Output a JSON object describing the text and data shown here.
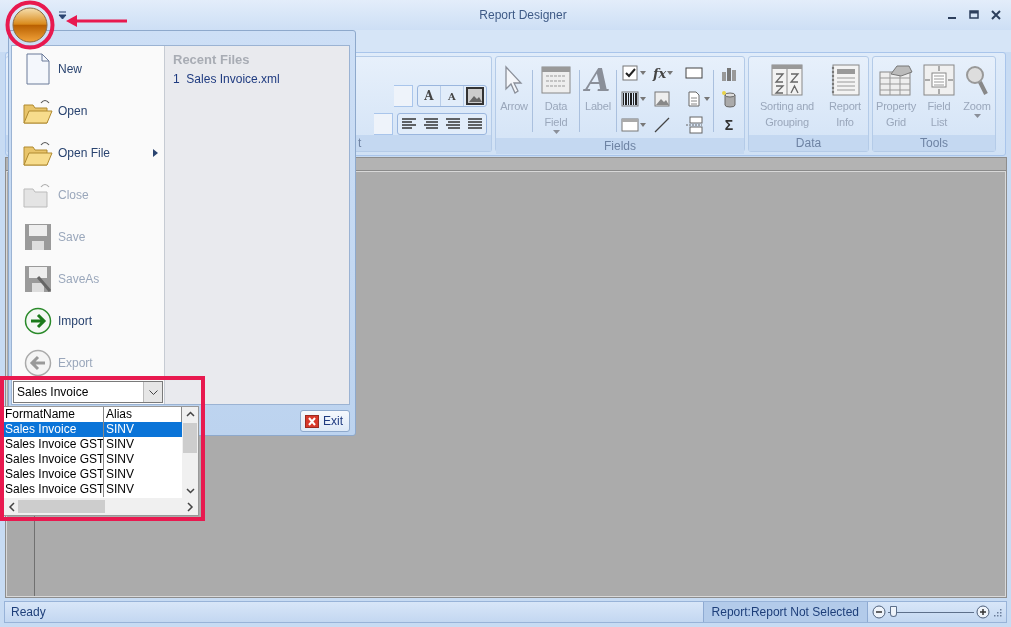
{
  "window": {
    "title": "Report Designer"
  },
  "ribbon": {
    "format_group": {
      "label": "t",
      "grow_glyph": "A",
      "shrink_glyph": "A"
    },
    "groups": [
      {
        "label": "Fields",
        "buttons": [
          {
            "label": "Arrow",
            "kind": "arrow",
            "disabled": true,
            "menu": false
          },
          {
            "label": "Data Field",
            "kind": "table",
            "disabled": true,
            "menu": true
          },
          {
            "label": "Label",
            "kind": "label",
            "disabled": true,
            "menu": false,
            "glyph": "A"
          }
        ],
        "tools": {
          "formula": "fx",
          "sum": "Σ"
        }
      },
      {
        "label": "Data",
        "buttons": [
          {
            "label": "Sorting and Grouping",
            "kind": "sort",
            "disabled": true,
            "menu": false
          },
          {
            "label": "Report Info",
            "kind": "info",
            "disabled": true,
            "menu": false
          }
        ]
      },
      {
        "label": "Tools",
        "buttons": [
          {
            "label": "Property Grid",
            "kind": "grid",
            "disabled": true,
            "menu": false
          },
          {
            "label": "Field List",
            "kind": "fieldlist",
            "disabled": true,
            "menu": false
          },
          {
            "label": "Zoom",
            "kind": "zoom",
            "disabled": true,
            "menu": true
          }
        ]
      }
    ]
  },
  "app_menu": {
    "items": [
      {
        "label": "New",
        "kind": "new",
        "disabled": false,
        "submenu": false
      },
      {
        "label": "Open",
        "kind": "open",
        "disabled": false,
        "submenu": false
      },
      {
        "label": "Open File",
        "kind": "open",
        "disabled": false,
        "submenu": true
      },
      {
        "label": "Close",
        "kind": "close",
        "disabled": true,
        "submenu": false
      },
      {
        "label": "Save",
        "kind": "save",
        "disabled": true,
        "submenu": false
      },
      {
        "label": "SaveAs",
        "kind": "saveas",
        "disabled": true,
        "submenu": false
      },
      {
        "label": "Import",
        "kind": "import",
        "disabled": false,
        "submenu": false
      },
      {
        "label": "Export",
        "kind": "export",
        "disabled": true,
        "submenu": false
      }
    ],
    "recent_title": "Recent Files",
    "recent": [
      {
        "number": "1",
        "name": "Sales Invoice.xml"
      }
    ],
    "exit": "Exit"
  },
  "format_picker": {
    "value": "Sales Invoice",
    "columns": [
      "FormatName",
      "Alias"
    ],
    "rows": [
      {
        "cells": [
          "Sales Invoice",
          "SINV"
        ],
        "selected": true
      },
      {
        "cells": [
          "Sales Invoice GST",
          "SINV"
        ],
        "selected": false
      },
      {
        "cells": [
          "Sales Invoice GST",
          "SINV"
        ],
        "selected": false
      },
      {
        "cells": [
          "Sales Invoice GST",
          "SINV"
        ],
        "selected": false
      },
      {
        "cells": [
          "Sales Invoice GST",
          "SINV"
        ],
        "selected": false
      }
    ]
  },
  "status_bar": {
    "text": "Ready",
    "report": "Report:Report Not Selected",
    "zoom": {
      "level": 0.06
    }
  }
}
